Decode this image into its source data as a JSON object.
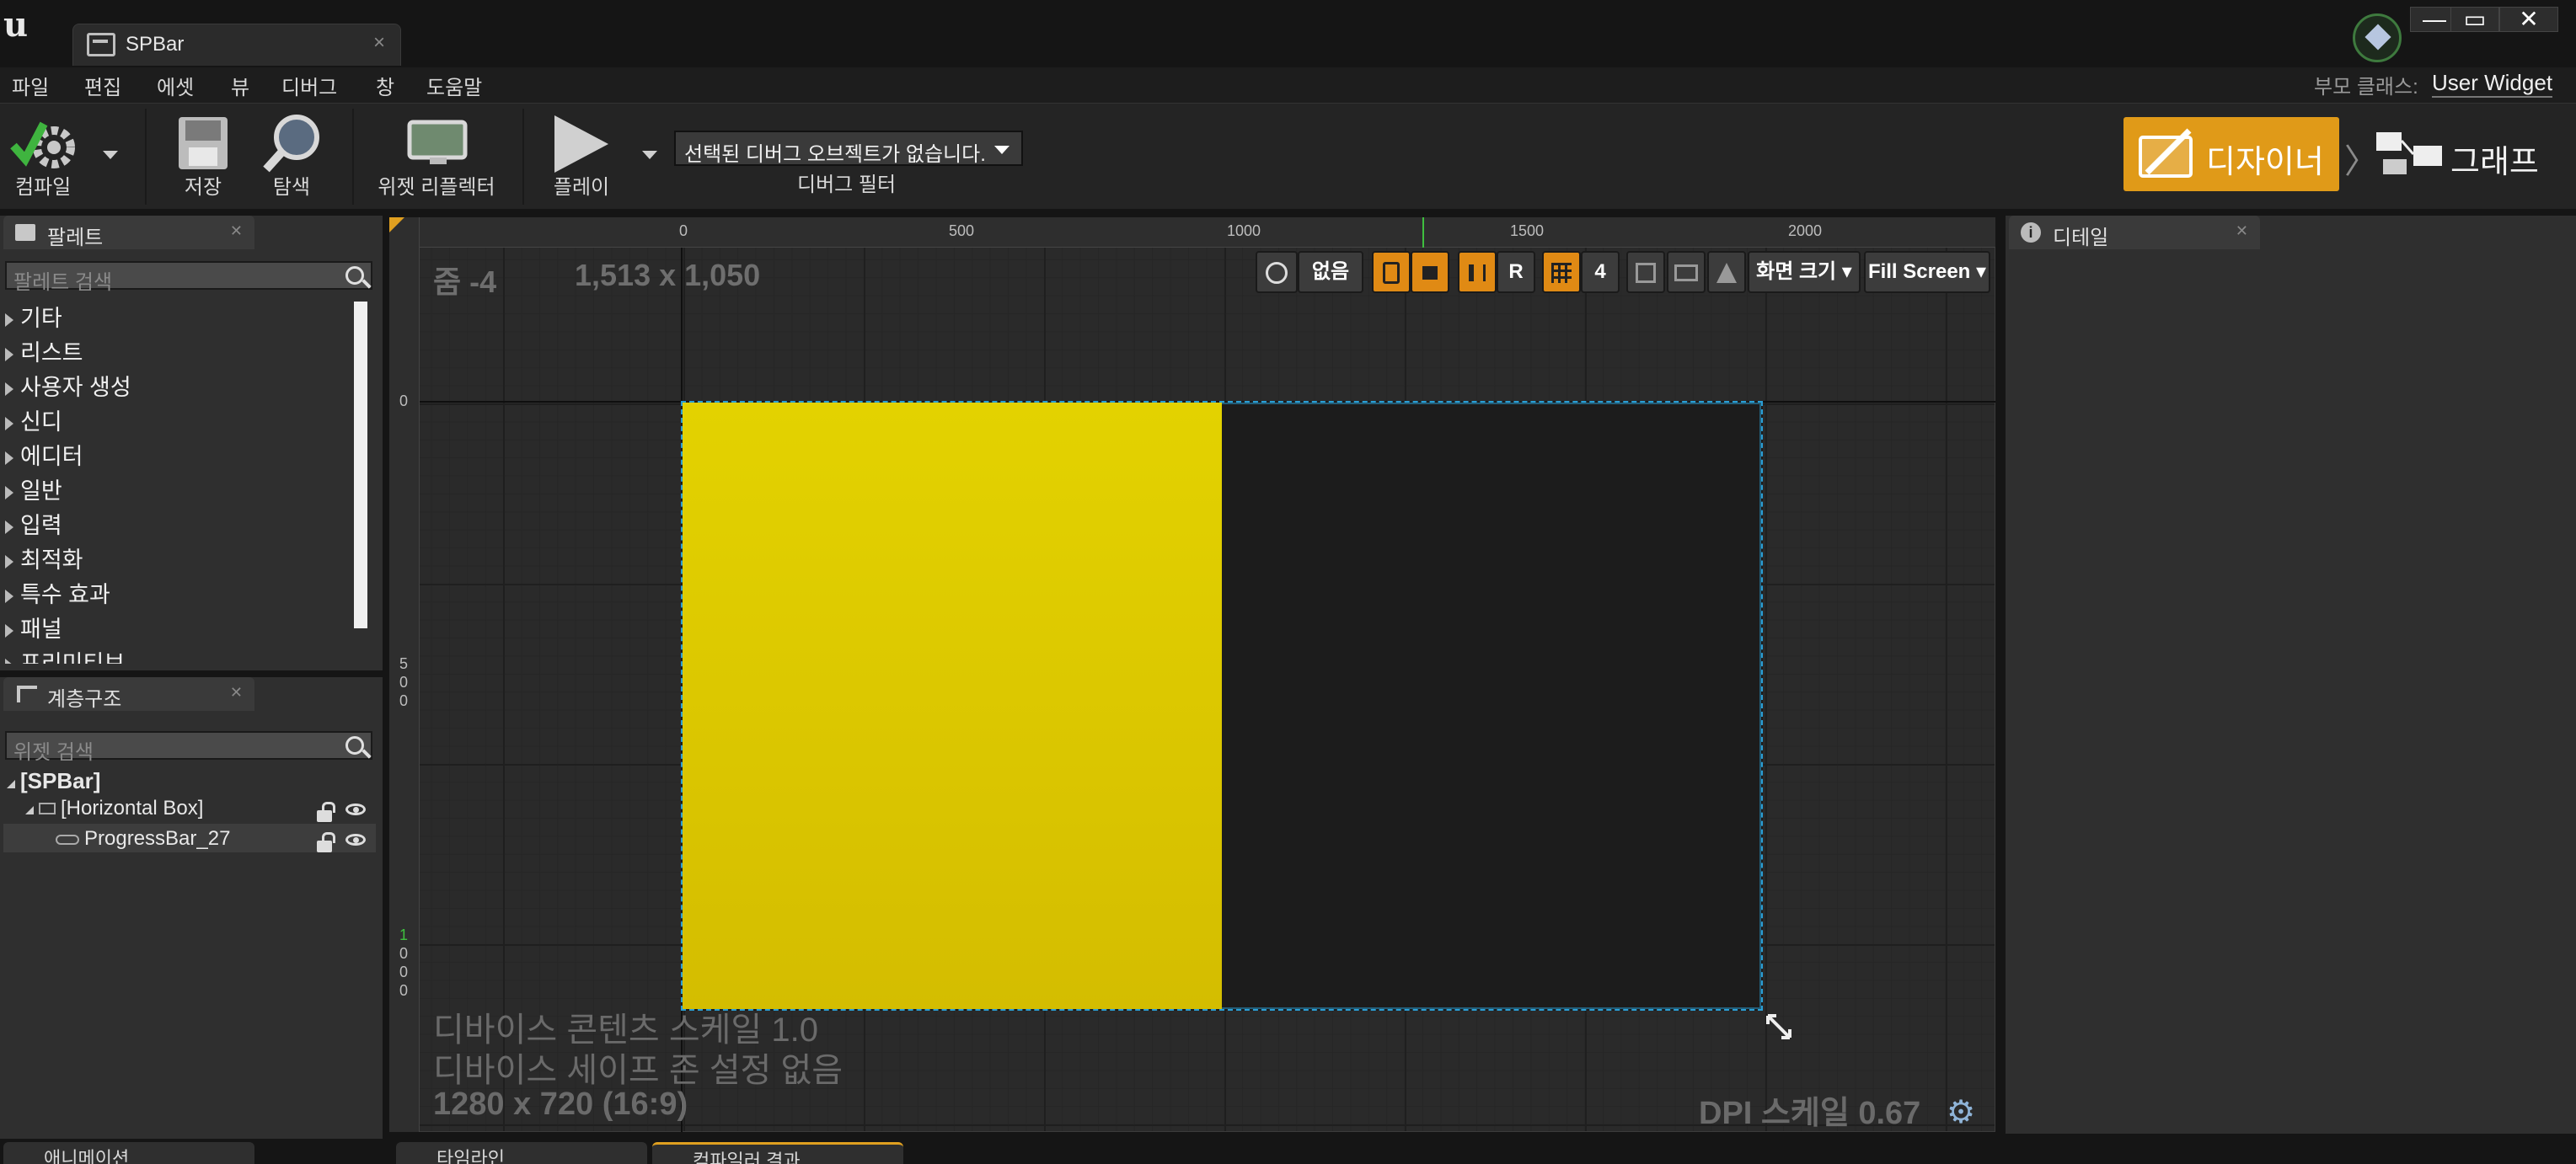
{
  "window": {
    "tab_title": "SPBar",
    "tab_close": "×",
    "minimize": "—",
    "maximize": "▭",
    "close": "✕"
  },
  "menu": [
    "파일",
    "편집",
    "에셋",
    "뷰",
    "디버그",
    "창",
    "도움말"
  ],
  "parent_class": {
    "label": "부모 클래스:",
    "value": "User Widget"
  },
  "toolbar": {
    "compile": "컴파일",
    "save": "저장",
    "browse": "탐색",
    "widget_reflector": "위젯 리플렉터",
    "play": "플레이",
    "debug_object": "선택된 디버그 오브젝트가 없습니다.",
    "debug_filter": "디버그 필터"
  },
  "mode": {
    "designer": "디자이너",
    "graph": "그래프"
  },
  "palette": {
    "tab": "팔레트",
    "search_placeholder": "팔레트 검색",
    "categories": [
      "기타",
      "리스트",
      "사용자 생성",
      "신디",
      "에디터",
      "일반",
      "입력",
      "최적화",
      "특수 효과",
      "패널",
      "프리미티브"
    ]
  },
  "hierarchy": {
    "tab": "계층구조",
    "search_placeholder": "위젯 검색",
    "items": [
      "[SPBar]",
      "[Horizontal Box]",
      "ProgressBar_27"
    ]
  },
  "details": {
    "tab": "디테일"
  },
  "designer": {
    "zoom": "줌 -4",
    "size": "1,513 x 1,050",
    "ruler_top": [
      "0",
      "500",
      "1000",
      "1500",
      "2000"
    ],
    "ruler_left_0": "0",
    "ruler_left_500": [
      "5",
      "0",
      "0"
    ],
    "ruler_left_1000": [
      "1",
      "0",
      "0",
      "0"
    ],
    "none_label": "없음",
    "r_label": "R",
    "grid_snap": "4",
    "screen_size": "화면 크기",
    "fill_screen": "Fill Screen",
    "device_content_scale": "디바이스 콘텐츠 스케일 1.0",
    "device_safe_zone": "디바이스 세이프 존 설정 없음",
    "resolution": "1280 x 720 (16:9)",
    "dpi_scale": "DPI 스케일 0.67",
    "progress_percent": 50
  },
  "bottom_tabs": [
    "애니메이션",
    "타임라인",
    "컴파일러 결과"
  ],
  "colors": {
    "accent": "#e09a18",
    "progress": "#e3d200",
    "selection": "#2a9fd6"
  }
}
